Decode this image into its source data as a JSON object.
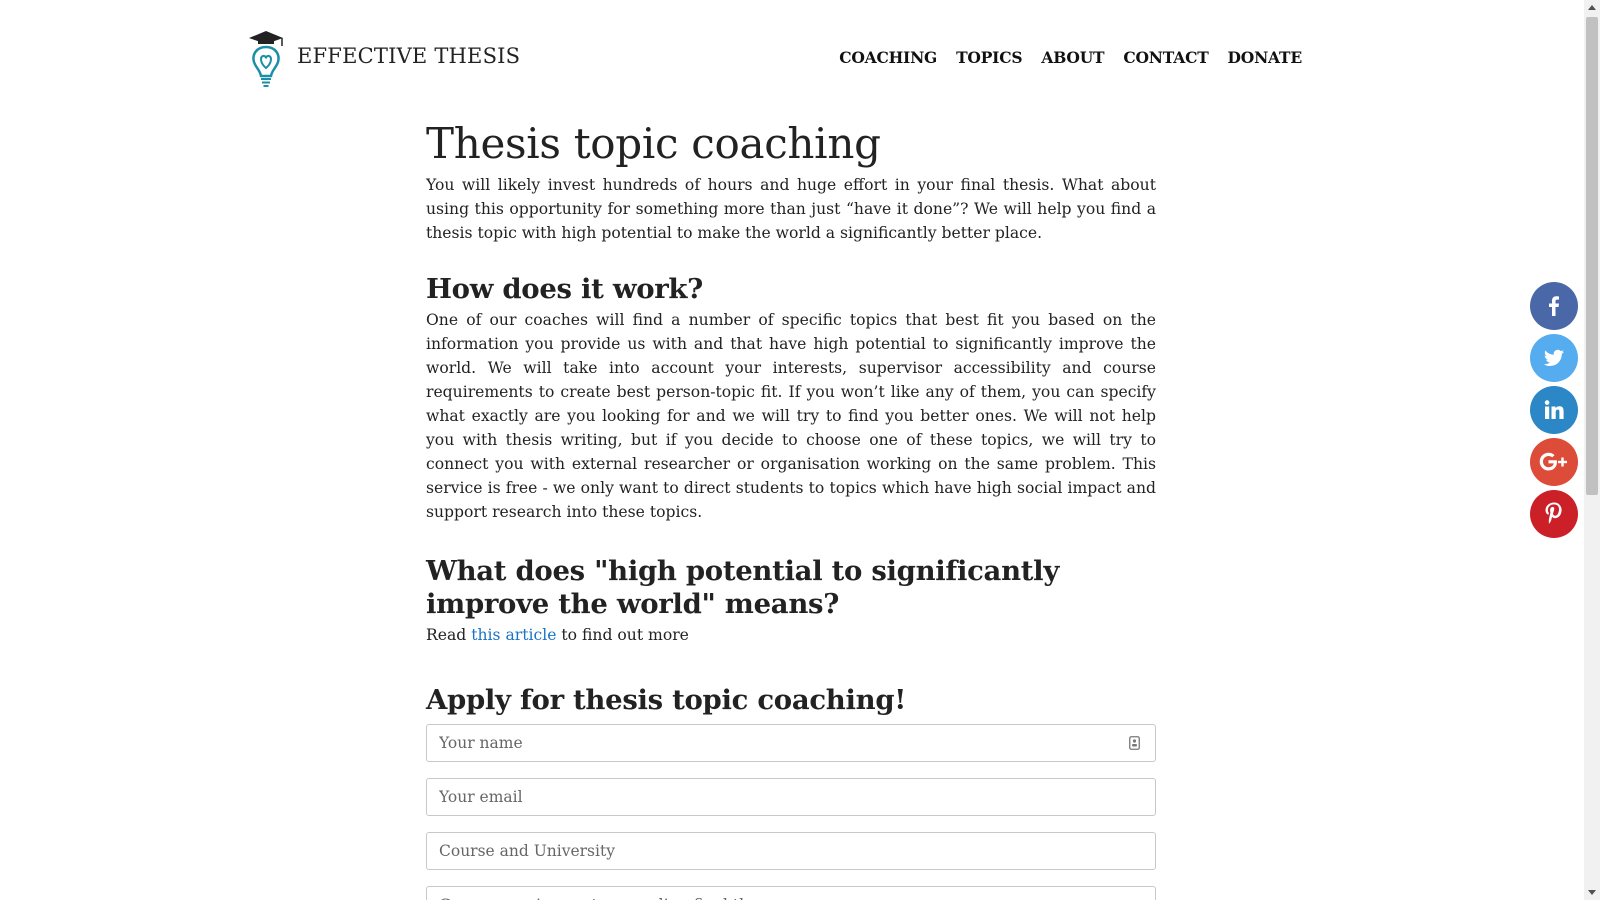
{
  "site": {
    "brand": "EFFECTIVE THESIS"
  },
  "nav": {
    "items": [
      {
        "label": "COACHING"
      },
      {
        "label": "TOPICS"
      },
      {
        "label": "ABOUT"
      },
      {
        "label": "CONTACT"
      },
      {
        "label": "DONATE"
      }
    ]
  },
  "main": {
    "title": "Thesis topic coaching",
    "intro": "You will likely invest hundreds of hours and huge effort in your final thesis. What about using this opportunity for something more than just “have it done”? We will help you find a thesis topic with high potential to make the world a significantly better place.",
    "how_heading": "How does it work?",
    "how_text": "One of our coaches will find a number of specific topics that best fit you based on the information you provide us with and that have high potential to significantly improve the world. We will take into account your interests, supervisor accessibility and course requirements to create best person-topic fit. If you won’t like any of them, you can specify what exactly are you looking for and we will try to find you better ones. We will not help you with thesis writing, but if you decide to choose one of these topics, we will try to connect you with external researcher or organisation working on the same problem. This service is free - we only want to direct students to topics which have high social impact and support research into these topics.",
    "what_heading": "What does \"high potential to significantly improve the world\" means?",
    "what_prefix": "Read ",
    "what_link": "this article",
    "what_suffix": " to find out more",
    "apply_heading": "Apply for thesis topic coaching!"
  },
  "form": {
    "name_placeholder": "Your name",
    "email_placeholder": "Your email",
    "course_placeholder": "Course and University",
    "requirements_placeholder": "Course requirements regarding final theses"
  },
  "social": {
    "facebook_color": "#4a67a8",
    "twitter_color": "#55acee",
    "linkedin_color": "#2b87c5",
    "googleplus_color": "#dd4b39",
    "pinterest_color": "#cb2027"
  },
  "colors": {
    "link": "#1a73c9",
    "logo_accent": "#1a8fa8"
  }
}
